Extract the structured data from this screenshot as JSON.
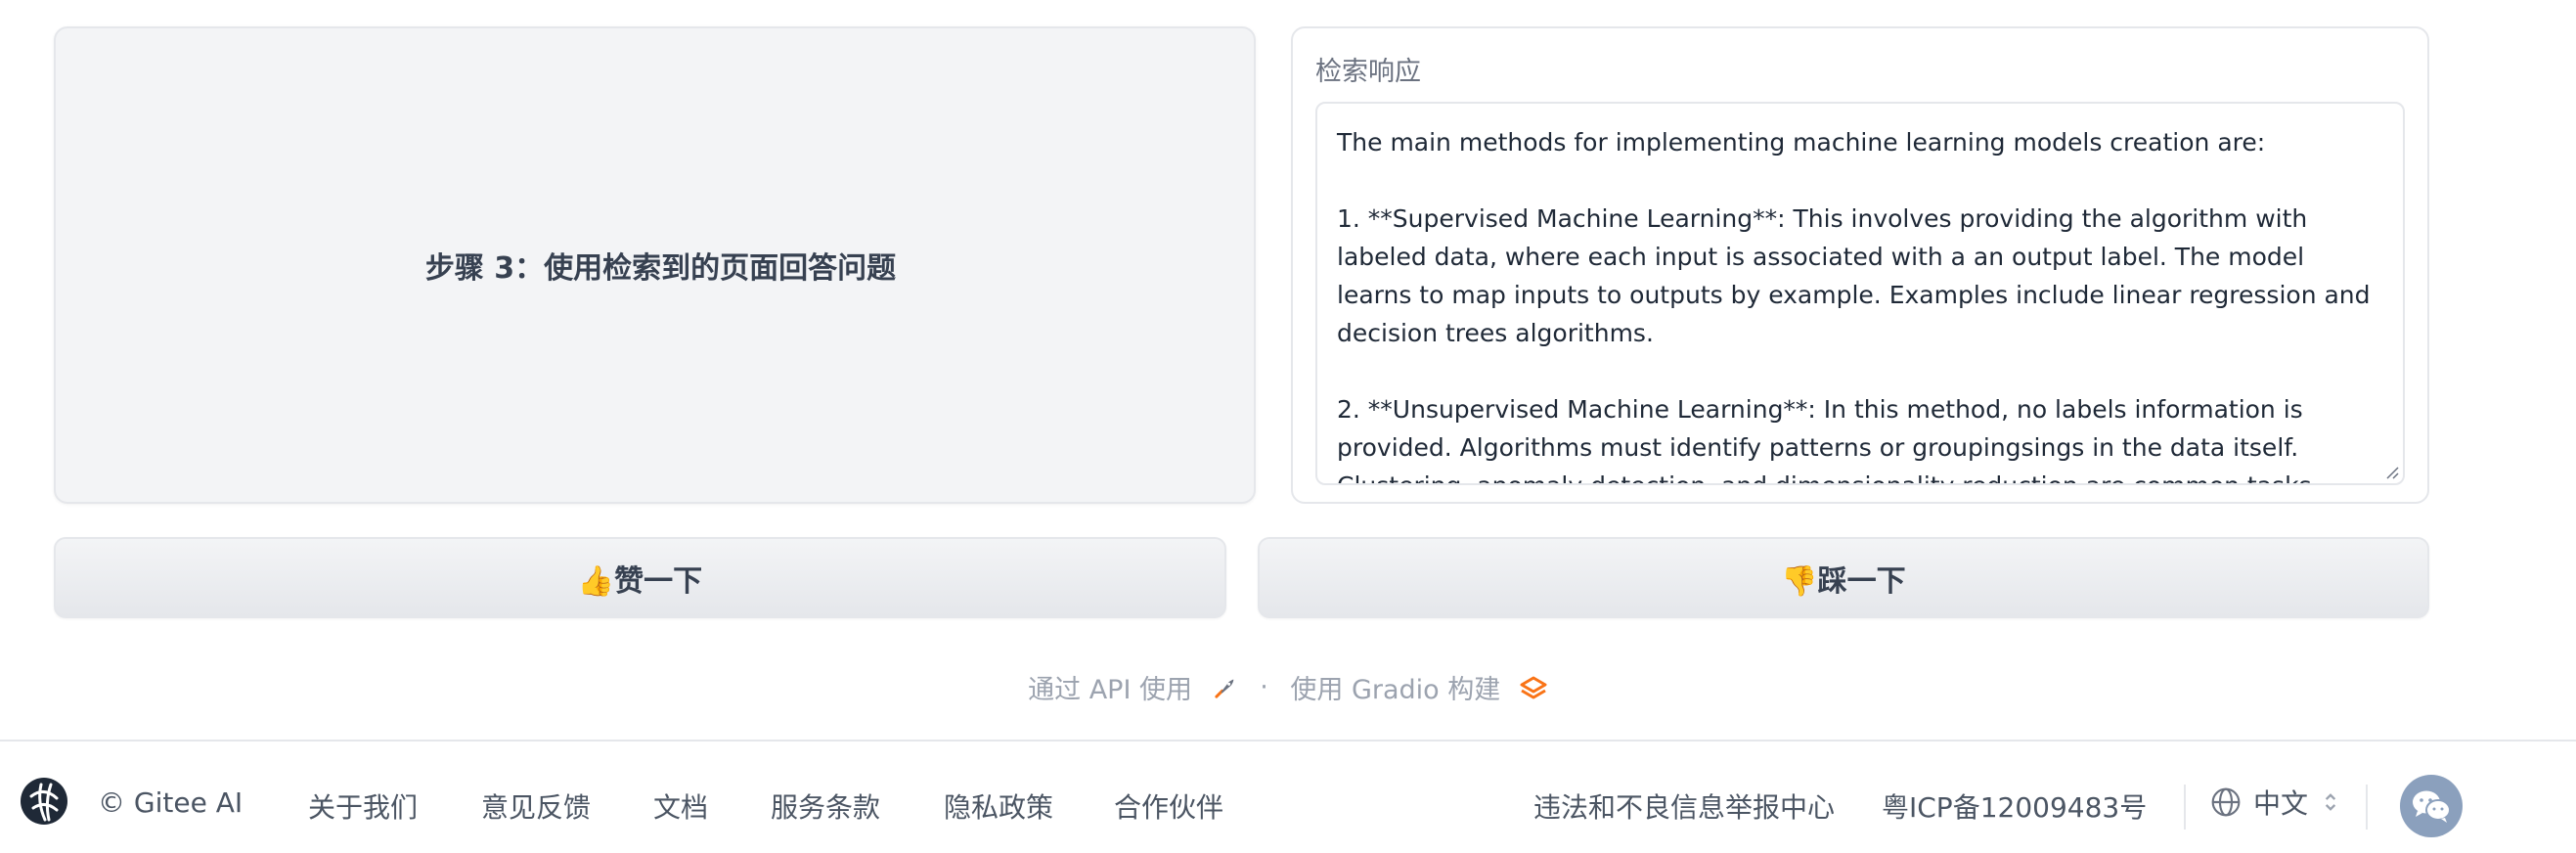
{
  "step": {
    "title": "步骤 3：使用检索到的页面回答问题"
  },
  "response": {
    "label": "检索响应",
    "text": "The main methods for implementing machine learning models creation are:\n\n1. **Supervised Machine Learning**: This involves providing the algorithm with labeled data, where each input is associated with a an output label. The model learns to map inputs to outputs by example. Examples include linear regression and decision trees algorithms.\n\n2. **Unsupervised Machine Learning**: In this method, no labels information is provided. Algorithms must identify patterns or groupingsings in the data itself. Clustering, anomaly detection, and dimensionality reduction are common tasks."
  },
  "buttons": {
    "like": "👍赞一下",
    "dislike": "👎踩一下"
  },
  "credits": {
    "api_label": "通过 API 使用",
    "separator": "·",
    "gradio_label": "使用 Gradio 构建"
  },
  "footer": {
    "brand": "© Gitee AI",
    "links": [
      "关于我们",
      "意见反馈",
      "文档",
      "服务条款",
      "隐私政策",
      "合作伙伴"
    ],
    "report_center": "违法和不良信息举报中心",
    "icp": "粤ICP备12009483号",
    "language": "中文"
  },
  "icons": {
    "api": "rocket-icon",
    "gradio": "gradio-logo-icon",
    "language": "globe-icon",
    "language_toggle": "chevron-updown-icon",
    "wechat": "wechat-icon"
  },
  "colors": {
    "panel_bg": "#f3f4f6",
    "footer_text": "#4b5563",
    "credits_text": "#9ca3af",
    "gradio_accent": "#f97316",
    "wechat_bg": "#8ba0bd"
  }
}
